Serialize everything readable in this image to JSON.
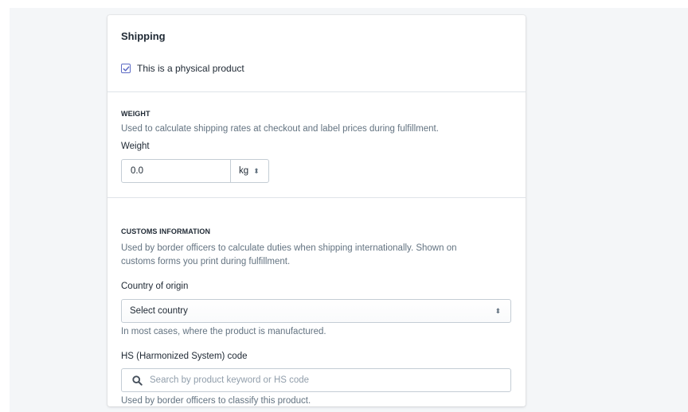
{
  "shipping": {
    "title": "Shipping",
    "physical_product_label": "This is a physical product",
    "physical_product_checked": true
  },
  "weight": {
    "heading": "WEIGHT",
    "description": "Used to calculate shipping rates at checkout and label prices during fulfillment.",
    "label": "Weight",
    "value": "0.0",
    "unit": "kg",
    "unit_arrows": "⬍"
  },
  "customs": {
    "heading": "CUSTOMS INFORMATION",
    "description_line1": "Used by border officers to calculate duties when shipping internationally. Shown on",
    "description_line2": "customs forms you print during fulfillment.",
    "country_label": "Country of origin",
    "country_value": "Select country",
    "country_arrows": "⬍",
    "country_help": "In most cases, where the product is manufactured.",
    "hs_label": "HS (Harmonized System) code",
    "hs_placeholder": "Search by product keyword or HS code",
    "hs_help": "Used by border officers to classify this product."
  },
  "colors": {
    "accent": "#5c6ac4",
    "border": "#c4cdd5",
    "subdued_text": "#637381",
    "background": "#f4f6f8"
  },
  "icons": {
    "checkbox": "check-icon",
    "search": "search-icon"
  }
}
